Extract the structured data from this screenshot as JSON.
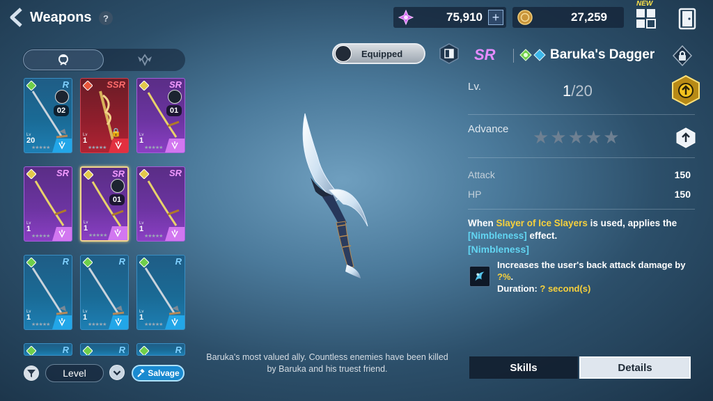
{
  "header": {
    "title": "Weapons",
    "help": "?"
  },
  "currencies": [
    {
      "icon": "crystal-icon",
      "value": "75,910",
      "plus": "+"
    },
    {
      "icon": "gold-coin-icon",
      "value": "27,259"
    }
  ],
  "topright": {
    "new_badge": "NEW"
  },
  "weapons": [
    {
      "rank": "R",
      "lv_label": "Lv",
      "level": "20",
      "count": "02",
      "type": "r"
    },
    {
      "rank": "SSR",
      "lv_label": "Lv",
      "level": "1",
      "type": "ssr",
      "locked": true
    },
    {
      "rank": "SR",
      "lv_label": "Lv",
      "level": "1",
      "count": "01",
      "type": "sr"
    },
    {
      "rank": "SR",
      "lv_label": "Lv",
      "level": "1",
      "type": "sr"
    },
    {
      "rank": "SR",
      "lv_label": "Lv",
      "level": "1",
      "count": "01",
      "type": "sr",
      "selected": true
    },
    {
      "rank": "SR",
      "lv_label": "Lv",
      "level": "1",
      "type": "sr"
    },
    {
      "rank": "R",
      "lv_label": "Lv",
      "level": "1",
      "type": "r"
    },
    {
      "rank": "R",
      "lv_label": "Lv",
      "level": "1",
      "type": "r"
    },
    {
      "rank": "R",
      "lv_label": "Lv",
      "level": "1",
      "type": "r"
    }
  ],
  "partial_ranks": [
    "R",
    "R",
    "R"
  ],
  "controls": {
    "sort_label": "Level",
    "salvage_label": "Salvage"
  },
  "center": {
    "equipped_label": "Equipped",
    "description": "Baruka's most valued ally. Countless enemies have been killed by Baruka and his truest friend."
  },
  "detail": {
    "rank": "SR",
    "name": "Baruka's Dagger",
    "lv_label": "Lv.",
    "level": "1",
    "level_sep": "/",
    "level_max": "20",
    "advance_label": "Advance",
    "advance_stars": "★★★★★",
    "stats": [
      {
        "label": "Attack",
        "value": "150"
      },
      {
        "label": "HP",
        "value": "150"
      }
    ],
    "effect": {
      "prefix": "When ",
      "skill": "Slayer of Ice Slayers",
      "middle": " is used, applies the ",
      "buff": "[Nimbleness]",
      "suffix": " effect."
    },
    "buff_title": "[Nimbleness]",
    "buff_desc_line1": "Increases the user's back attack damage by ",
    "buff_desc_pct": "?%",
    "buff_desc_line1_end": ".",
    "buff_duration_label": "Duration: ",
    "buff_duration_value": "? second(s)"
  },
  "bottom_tabs": {
    "skills": "Skills",
    "details": "Details"
  },
  "colors": {
    "accent_cyan": "#62d5f2",
    "accent_yellow": "#f6d03c",
    "sr_pink": "#e68cff",
    "ssr_red": "#ff6b6b",
    "r_blue": "#7fd0ff"
  }
}
